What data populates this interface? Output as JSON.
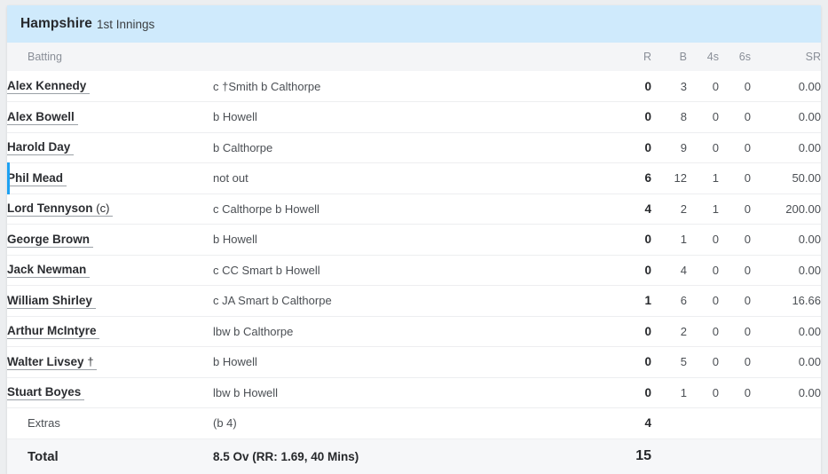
{
  "innings": {
    "team": "Hampshire",
    "label": "1st Innings"
  },
  "columns": {
    "batting": "Batting",
    "dismissal": "",
    "r": "R",
    "b": "B",
    "fours": "4s",
    "sixes": "6s",
    "sr": "SR"
  },
  "batsmen": [
    {
      "name": "Alex Kennedy",
      "role": "",
      "dismissal": "c †Smith b Calthorpe",
      "r": "0",
      "b": "3",
      "fours": "0",
      "sixes": "0",
      "sr": "0.00",
      "active": false
    },
    {
      "name": "Alex Bowell",
      "role": "",
      "dismissal": "b Howell",
      "r": "0",
      "b": "8",
      "fours": "0",
      "sixes": "0",
      "sr": "0.00",
      "active": false
    },
    {
      "name": "Harold Day",
      "role": "",
      "dismissal": "b Calthorpe",
      "r": "0",
      "b": "9",
      "fours": "0",
      "sixes": "0",
      "sr": "0.00",
      "active": false
    },
    {
      "name": "Phil Mead",
      "role": "",
      "dismissal": "not out",
      "r": "6",
      "b": "12",
      "fours": "1",
      "sixes": "0",
      "sr": "50.00",
      "active": true
    },
    {
      "name": "Lord Tennyson",
      "role": "(c)",
      "dismissal": "c Calthorpe b Howell",
      "r": "4",
      "b": "2",
      "fours": "1",
      "sixes": "0",
      "sr": "200.00",
      "active": false
    },
    {
      "name": "George Brown",
      "role": "",
      "dismissal": "b Howell",
      "r": "0",
      "b": "1",
      "fours": "0",
      "sixes": "0",
      "sr": "0.00",
      "active": false
    },
    {
      "name": "Jack Newman",
      "role": "",
      "dismissal": "c CC Smart b Howell",
      "r": "0",
      "b": "4",
      "fours": "0",
      "sixes": "0",
      "sr": "0.00",
      "active": false
    },
    {
      "name": "William Shirley",
      "role": "",
      "dismissal": "c JA Smart b Calthorpe",
      "r": "1",
      "b": "6",
      "fours": "0",
      "sixes": "0",
      "sr": "16.66",
      "active": false
    },
    {
      "name": "Arthur McIntyre",
      "role": "",
      "dismissal": "lbw b Calthorpe",
      "r": "0",
      "b": "2",
      "fours": "0",
      "sixes": "0",
      "sr": "0.00",
      "active": false
    },
    {
      "name": "Walter Livsey",
      "role": "†",
      "dismissal": "b Howell",
      "r": "0",
      "b": "5",
      "fours": "0",
      "sixes": "0",
      "sr": "0.00",
      "active": false
    },
    {
      "name": "Stuart Boyes",
      "role": "",
      "dismissal": "lbw b Howell",
      "r": "0",
      "b": "1",
      "fours": "0",
      "sixes": "0",
      "sr": "0.00",
      "active": false
    }
  ],
  "extras": {
    "label": "Extras",
    "detail": "(b 4)",
    "runs": "4"
  },
  "total": {
    "label": "Total",
    "detail": "8.5 Ov (RR: 1.69, 40 Mins)",
    "runs": "15"
  },
  "colors": {
    "header_band": "#cfeafc",
    "accent_active": "#1da1f2",
    "total_row_bg": "#f6f7f9"
  }
}
